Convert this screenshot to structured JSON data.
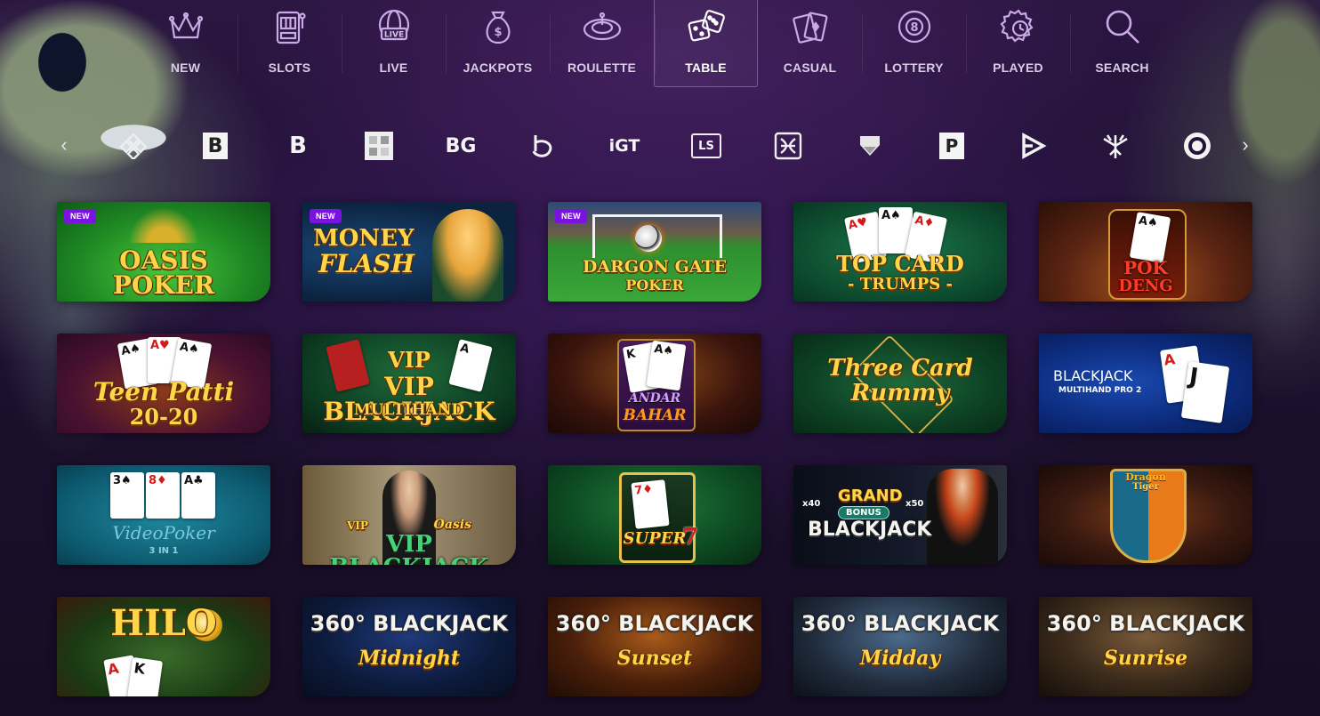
{
  "categories": [
    {
      "label": "NEW",
      "icon": "crown-icon",
      "active": false
    },
    {
      "label": "SLOTS",
      "icon": "slot-machine-icon",
      "active": false
    },
    {
      "label": "LIVE",
      "icon": "live-globe-icon",
      "active": false
    },
    {
      "label": "JACKPOTS",
      "icon": "money-bag-icon",
      "active": false
    },
    {
      "label": "ROULETTE",
      "icon": "roulette-wheel-icon",
      "active": false
    },
    {
      "label": "TABLE",
      "icon": "dice-icon",
      "active": true
    },
    {
      "label": "CASUAL",
      "icon": "playing-cards-icon",
      "active": false
    },
    {
      "label": "LOTTERY",
      "icon": "lottery-ball-icon",
      "active": false
    },
    {
      "label": "PLAYED",
      "icon": "history-icon",
      "active": false
    },
    {
      "label": "SEARCH",
      "icon": "search-icon",
      "active": false
    }
  ],
  "providers": {
    "prev": "‹",
    "next": "›",
    "items": [
      {
        "name": "diamond-grid-logo",
        "text": ""
      },
      {
        "name": "b-box-logo",
        "text": "B"
      },
      {
        "name": "split-b-logo",
        "text": "B"
      },
      {
        "name": "grid-box-logo",
        "text": ""
      },
      {
        "name": "bg-logo",
        "text": "BG"
      },
      {
        "name": "swirl-b-logo",
        "text": ""
      },
      {
        "name": "igt-logo",
        "text": "iGT"
      },
      {
        "name": "ls-logo",
        "text": "LS"
      },
      {
        "name": "knot-logo",
        "text": ""
      },
      {
        "name": "arrow-shield-logo",
        "text": ""
      },
      {
        "name": "p-box-logo",
        "text": "P"
      },
      {
        "name": "play-logo",
        "text": ""
      },
      {
        "name": "snowflake-logo",
        "text": ""
      },
      {
        "name": "target-logo",
        "text": ""
      }
    ]
  },
  "badge_new": "NEW",
  "games": [
    {
      "id": "oasis-poker",
      "title": "OASIS",
      "subtitle": "POKER",
      "new": true
    },
    {
      "id": "money-flash",
      "title": "MONEY",
      "subtitle": "FLASH",
      "new": true
    },
    {
      "id": "dargon-gate-poker",
      "title": "DARGON GATE",
      "subtitle": "POKER",
      "new": true
    },
    {
      "id": "top-card-trumps",
      "title": "TOP CARD",
      "subtitle": "- TRUMPS -",
      "new": false
    },
    {
      "id": "pok-deng",
      "title": "POK",
      "subtitle": "DENG",
      "new": false
    },
    {
      "id": "teen-patti",
      "title": "Teen Patti",
      "subtitle": "20-20",
      "new": false
    },
    {
      "id": "vip-blackjack-multihand",
      "title": "VIP BLACKJACK",
      "subtitle": "MULTIHAND",
      "new": false
    },
    {
      "id": "andar-bahar",
      "title": "ANDAR",
      "subtitle": "BAHAR",
      "new": false
    },
    {
      "id": "three-card-rummy",
      "title": "Three Card",
      "subtitle": "Rummy",
      "new": false
    },
    {
      "id": "blackjack-multihand-pro",
      "title": "BLACKJACK",
      "subtitle": "MULTIHAND PRO 2",
      "new": false
    },
    {
      "id": "video-poker",
      "title": "VideoPoker",
      "subtitle": "3 IN 1",
      "new": false
    },
    {
      "id": "vip-blackjack-oasis",
      "title": "VIP BLACKJACK",
      "subtitle": "Oasis",
      "new": false
    },
    {
      "id": "super-7",
      "title": "SUPER",
      "subtitle": "7",
      "new": false
    },
    {
      "id": "grand-bonus-blackjack",
      "title": "GRAND",
      "subtitle": "BLACKJACK",
      "badge": "BONUS",
      "mult_left": "x40",
      "mult_right": "x50",
      "new": false
    },
    {
      "id": "dragon-tiger",
      "title": "Dragon",
      "subtitle": "Tiger",
      "new": false
    },
    {
      "id": "hilo",
      "title": "HILO",
      "subtitle": "",
      "new": false
    },
    {
      "id": "360-blackjack-midnight",
      "title": "360° BLACKJACK",
      "subtitle": "Midnight",
      "new": false
    },
    {
      "id": "360-blackjack-sunset",
      "title": "360° BLACKJACK",
      "subtitle": "Sunset",
      "new": false
    },
    {
      "id": "360-blackjack-midday",
      "title": "360° BLACKJACK",
      "subtitle": "Midday",
      "new": false
    },
    {
      "id": "360-blackjack-sunrise",
      "title": "360° BLACKJACK",
      "subtitle": "Sunrise",
      "new": false
    }
  ],
  "colors": {
    "accent_new": "#7a12e0",
    "gold": "#ffd54a",
    "nav_text": "#d8cce6"
  }
}
